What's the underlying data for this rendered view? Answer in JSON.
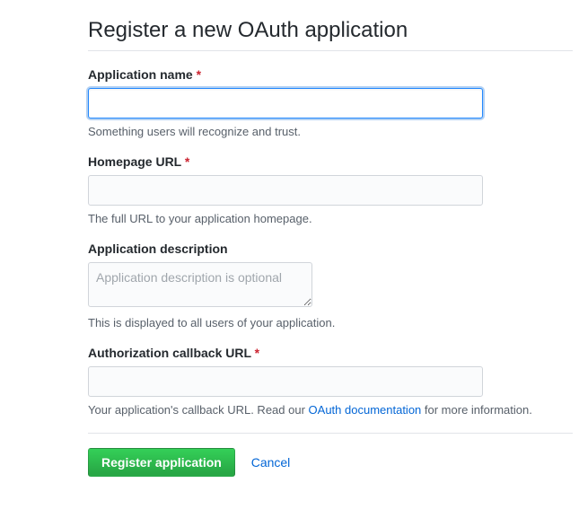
{
  "page": {
    "title": "Register a new OAuth application"
  },
  "form": {
    "appName": {
      "label": "Application name",
      "required": "*",
      "value": "",
      "help": "Something users will recognize and trust."
    },
    "homepageUrl": {
      "label": "Homepage URL",
      "required": "*",
      "value": "",
      "help": "The full URL to your application homepage."
    },
    "description": {
      "label": "Application description",
      "placeholder": "Application description is optional",
      "value": "",
      "help": "This is displayed to all users of your application."
    },
    "callbackUrl": {
      "label": "Authorization callback URL",
      "required": "*",
      "value": "",
      "helpPrefix": "Your application's callback URL. Read our ",
      "helpLink": "OAuth documentation",
      "helpSuffix": " for more information."
    }
  },
  "actions": {
    "submit": "Register application",
    "cancel": "Cancel"
  }
}
